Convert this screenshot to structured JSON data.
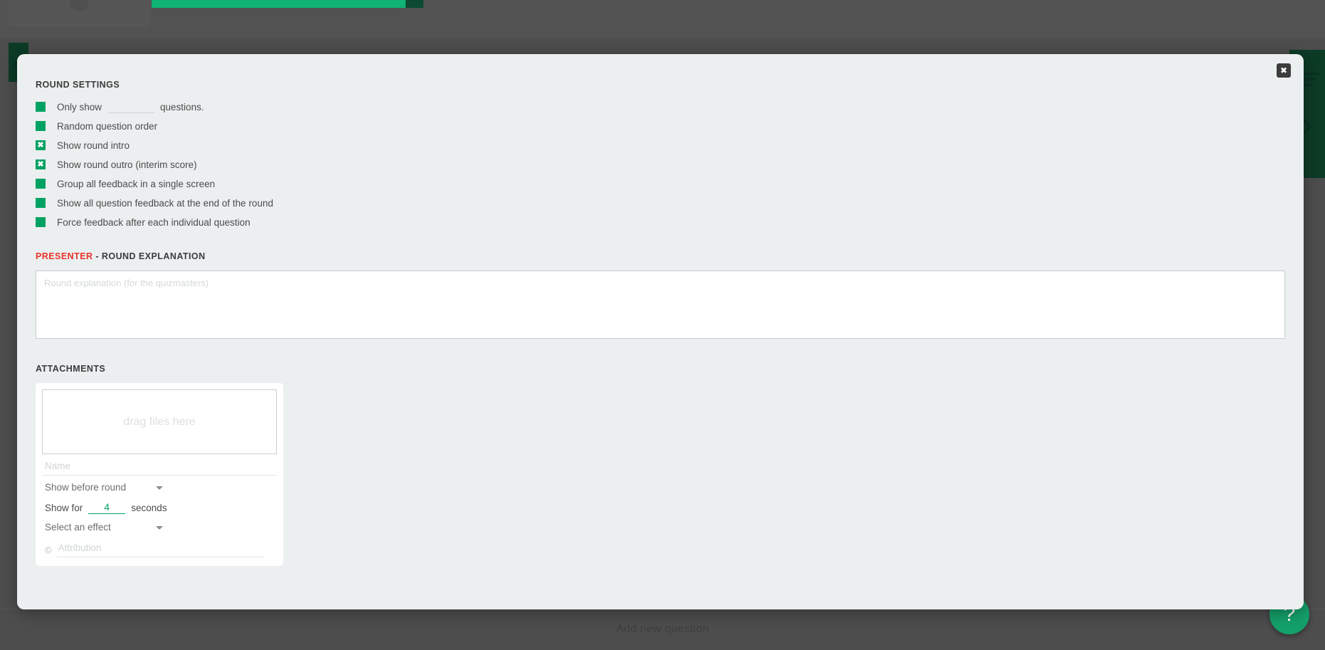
{
  "background": {
    "add_question_label": "Add new question",
    "help_label": "?"
  },
  "modal": {
    "close_icon": "✖",
    "round_settings": {
      "title": "ROUND SETTINGS",
      "only_show": {
        "prefix": "Only show",
        "value": "",
        "placeholder": "",
        "suffix": "questions."
      },
      "options": [
        {
          "label": "Random question order",
          "checked": false
        },
        {
          "label": "Show round intro",
          "checked": true
        },
        {
          "label": "Show round outro (interim score)",
          "checked": true
        },
        {
          "label": "Group all feedback in a single screen",
          "checked": false
        },
        {
          "label": "Show all question feedback at the end of the round",
          "checked": false
        },
        {
          "label": "Force feedback after each individual question",
          "checked": false
        }
      ]
    },
    "presenter": {
      "title_accent": "PRESENTER",
      "title_rest": " - ROUND EXPLANATION",
      "explanation_value": "",
      "explanation_placeholder": "Round explanation (for the quizmasters)"
    },
    "attachments": {
      "title": "ATTACHMENTS",
      "dropzone_label": "drag files here",
      "name_value": "",
      "name_placeholder": "Name",
      "timing_selected": "Show before round",
      "show_for_prefix": "Show for",
      "show_for_value": "4",
      "show_for_suffix": "seconds",
      "effect_selected": "Select an effect",
      "copyright_glyph": "©",
      "attribution_value": "",
      "attribution_placeholder": "Attribution"
    }
  },
  "colors": {
    "accent_green": "#00a263",
    "fab_green": "#14a06a",
    "presenter_red": "#e8332a",
    "modal_bg": "#eceff0"
  }
}
